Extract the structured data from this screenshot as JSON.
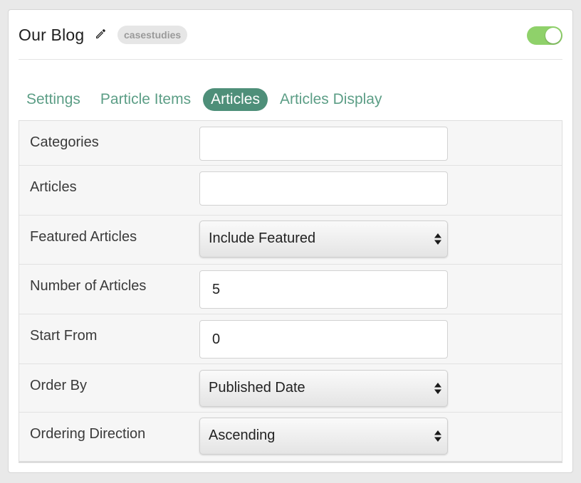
{
  "header": {
    "title": "Our Blog",
    "badge": "casestudies",
    "toggle_on": true,
    "accent_color": "#8fd16a"
  },
  "tabs": [
    {
      "label": "Settings",
      "active": false
    },
    {
      "label": "Particle Items",
      "active": false
    },
    {
      "label": "Articles",
      "active": true
    },
    {
      "label": "Articles Display",
      "active": false
    }
  ],
  "tab_color": "#5c9e86",
  "form": {
    "categories": {
      "label": "Categories",
      "value": ""
    },
    "articles": {
      "label": "Articles",
      "value": ""
    },
    "featured": {
      "label": "Featured Articles",
      "value": "Include Featured"
    },
    "number": {
      "label": "Number of Articles",
      "value": "5"
    },
    "start": {
      "label": "Start From",
      "value": "0"
    },
    "order_by": {
      "label": "Order By",
      "value": "Published Date"
    },
    "direction": {
      "label": "Ordering Direction",
      "value": "Ascending"
    }
  }
}
